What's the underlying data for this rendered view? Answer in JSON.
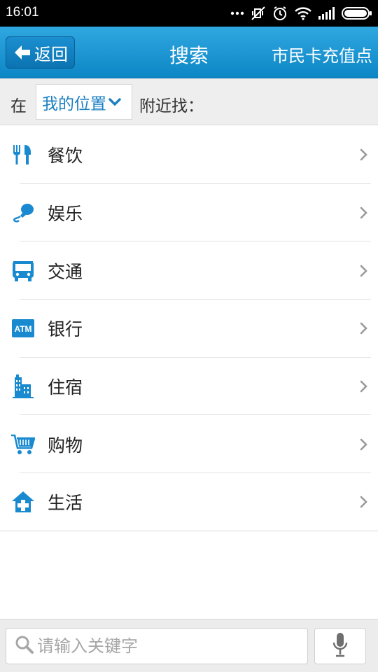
{
  "status_bar": {
    "time": "16:01"
  },
  "header": {
    "back_label": "返回",
    "title": "搜索",
    "right_link": "市民卡充值点"
  },
  "location_bar": {
    "prefix": "在",
    "selected_location": "我的位置",
    "suffix": "附近找："
  },
  "categories": [
    {
      "label": "餐饮",
      "icon": "restaurant-icon"
    },
    {
      "label": "娱乐",
      "icon": "entertainment-icon"
    },
    {
      "label": "交通",
      "icon": "bus-icon"
    },
    {
      "label": "银行",
      "icon": "atm-icon",
      "icon_text": "ATM"
    },
    {
      "label": "住宿",
      "icon": "hotel-icon"
    },
    {
      "label": "购物",
      "icon": "shopping-cart-icon"
    },
    {
      "label": "生活",
      "icon": "life-service-icon"
    }
  ],
  "search": {
    "placeholder": "请输入关键字",
    "value": ""
  },
  "colors": {
    "accent": "#1492d6",
    "icon_blue": "#1a8ad0"
  }
}
